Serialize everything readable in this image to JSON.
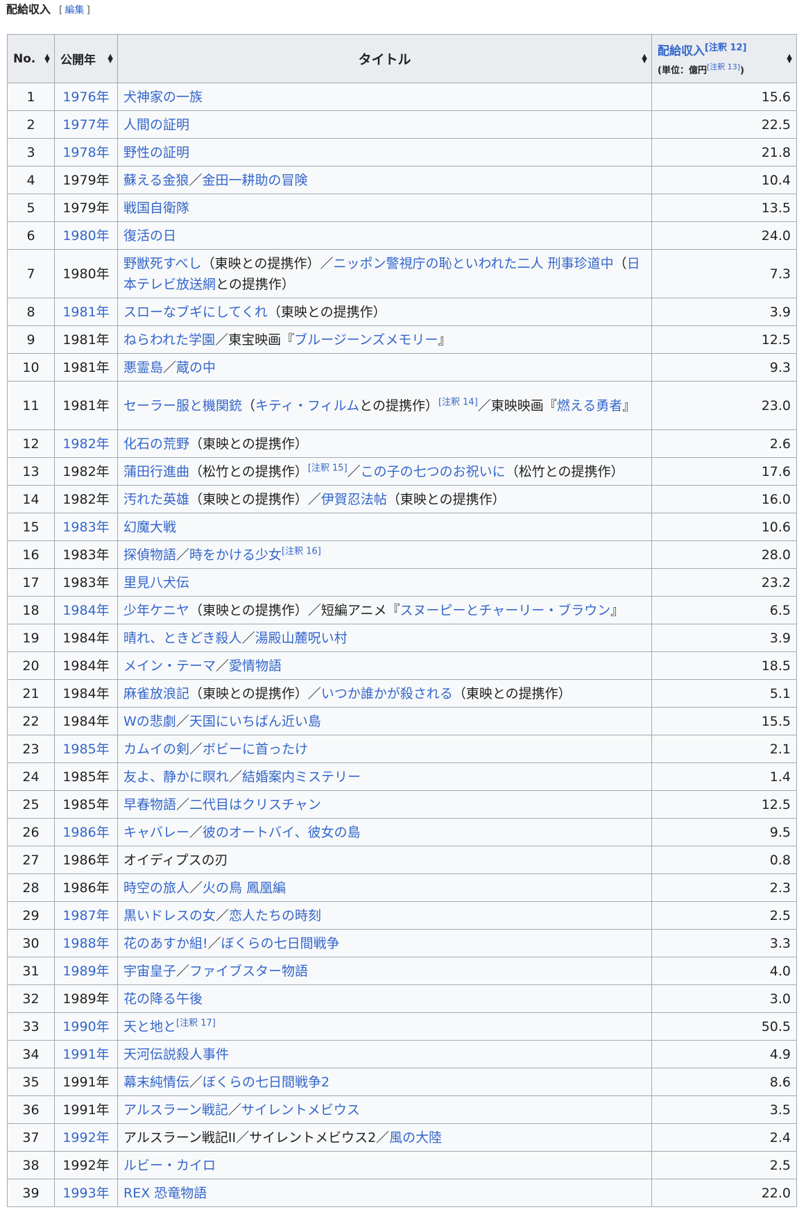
{
  "section": {
    "title": "配給収入",
    "edit_open": "[",
    "edit_label": "編集",
    "edit_close": "]"
  },
  "headers": {
    "no": "No.",
    "year": "公開年",
    "title": "タイトル",
    "revenue": "配給収入",
    "revenue_note": "[注釈 12]",
    "unit_prefix": "(単位：億円",
    "unit_note": "[注釈 13]",
    "unit_suffix": ")"
  },
  "rows": [
    {
      "no": "1",
      "year": "1976年",
      "year_link": true,
      "parts": [
        {
          "t": "犬神家の一族",
          "l": true
        }
      ],
      "rev": "15.6"
    },
    {
      "no": "2",
      "year": "1977年",
      "year_link": true,
      "parts": [
        {
          "t": "人間の証明",
          "l": true
        }
      ],
      "rev": "22.5"
    },
    {
      "no": "3",
      "year": "1978年",
      "year_link": true,
      "parts": [
        {
          "t": "野性の証明",
          "l": true
        }
      ],
      "rev": "21.8"
    },
    {
      "no": "4",
      "year": "1979年",
      "year_link": false,
      "parts": [
        {
          "t": "蘇える金狼",
          "l": true
        },
        {
          "t": "／",
          "l": false
        },
        {
          "t": "金田一耕助の冒険",
          "l": true
        }
      ],
      "rev": "10.4"
    },
    {
      "no": "5",
      "year": "1979年",
      "year_link": false,
      "parts": [
        {
          "t": "戦国自衛隊",
          "l": true
        }
      ],
      "rev": "13.5"
    },
    {
      "no": "6",
      "year": "1980年",
      "year_link": true,
      "parts": [
        {
          "t": "復活の日",
          "l": true
        }
      ],
      "rev": "24.0"
    },
    {
      "no": "7",
      "year": "1980年",
      "year_link": false,
      "tall": true,
      "parts": [
        {
          "t": "野獣死すべし",
          "l": true
        },
        {
          "t": "（東映との提携作）／",
          "l": false
        },
        {
          "t": "ニッポン警視庁の恥といわれた二人 刑事珍道中",
          "l": true
        },
        {
          "t": "（",
          "l": false
        },
        {
          "t": "日本テレビ放送網",
          "l": true
        },
        {
          "t": "との提携作）",
          "l": false
        }
      ],
      "rev": "7.3"
    },
    {
      "no": "8",
      "year": "1981年",
      "year_link": true,
      "parts": [
        {
          "t": "スローなブギにしてくれ",
          "l": true
        },
        {
          "t": "（東映との提携作）",
          "l": false
        }
      ],
      "rev": "3.9"
    },
    {
      "no": "9",
      "year": "1981年",
      "year_link": false,
      "parts": [
        {
          "t": "ねらわれた学園",
          "l": true
        },
        {
          "t": "／東宝映画『",
          "l": false
        },
        {
          "t": "ブルージーンズメモリー",
          "l": true
        },
        {
          "t": "』",
          "l": false
        }
      ],
      "rev": "12.5"
    },
    {
      "no": "10",
      "year": "1981年",
      "year_link": false,
      "parts": [
        {
          "t": "悪霊島",
          "l": true
        },
        {
          "t": "／",
          "l": false
        },
        {
          "t": "蔵の中",
          "l": true
        }
      ],
      "rev": "9.3"
    },
    {
      "no": "11",
      "year": "1981年",
      "year_link": false,
      "tall": true,
      "parts": [
        {
          "t": "セーラー服と機関銃",
          "l": true
        },
        {
          "t": "（",
          "l": false
        },
        {
          "t": "キティ・フィルム",
          "l": true
        },
        {
          "t": "との提携作）",
          "l": false
        },
        {
          "t": "[注釈 14]",
          "n": true
        },
        {
          "t": "／東映映画『",
          "l": false
        },
        {
          "t": "燃える勇者",
          "l": true
        },
        {
          "t": "』",
          "l": false
        }
      ],
      "rev": "23.0"
    },
    {
      "no": "12",
      "year": "1982年",
      "year_link": true,
      "parts": [
        {
          "t": "化石の荒野",
          "l": true
        },
        {
          "t": "（東映との提携作）",
          "l": false
        }
      ],
      "rev": "2.6"
    },
    {
      "no": "13",
      "year": "1982年",
      "year_link": false,
      "parts": [
        {
          "t": "蒲田行進曲",
          "l": true
        },
        {
          "t": "（松竹との提携作）",
          "l": false
        },
        {
          "t": "[注釈 15]",
          "n": true
        },
        {
          "t": "／",
          "l": false
        },
        {
          "t": "この子の七つのお祝いに",
          "l": true
        },
        {
          "t": "（松竹との提携作）",
          "l": false
        }
      ],
      "rev": "17.6"
    },
    {
      "no": "14",
      "year": "1982年",
      "year_link": false,
      "parts": [
        {
          "t": "汚れた英雄",
          "l": true
        },
        {
          "t": "（東映との提携作）／",
          "l": false
        },
        {
          "t": "伊賀忍法帖",
          "l": true
        },
        {
          "t": "（東映との提携作）",
          "l": false
        }
      ],
      "rev": "16.0"
    },
    {
      "no": "15",
      "year": "1983年",
      "year_link": true,
      "parts": [
        {
          "t": "幻魔大戦",
          "l": true
        }
      ],
      "rev": "10.6"
    },
    {
      "no": "16",
      "year": "1983年",
      "year_link": false,
      "parts": [
        {
          "t": "探偵物語",
          "l": true
        },
        {
          "t": "／",
          "l": false
        },
        {
          "t": "時をかける少女",
          "l": true
        },
        {
          "t": "[注釈 16]",
          "n": true
        }
      ],
      "rev": "28.0"
    },
    {
      "no": "17",
      "year": "1983年",
      "year_link": false,
      "parts": [
        {
          "t": "里見八犬伝",
          "l": true
        }
      ],
      "rev": "23.2"
    },
    {
      "no": "18",
      "year": "1984年",
      "year_link": true,
      "parts": [
        {
          "t": "少年ケニヤ",
          "l": true
        },
        {
          "t": "（東映との提携作）／短編アニメ『",
          "l": false
        },
        {
          "t": "スヌーピーとチャーリー・ブラウン",
          "l": true
        },
        {
          "t": "』",
          "l": false
        }
      ],
      "rev": "6.5"
    },
    {
      "no": "19",
      "year": "1984年",
      "year_link": false,
      "parts": [
        {
          "t": "晴れ、ときどき殺人",
          "l": true
        },
        {
          "t": "／",
          "l": false
        },
        {
          "t": "湯殿山麓呪い村",
          "l": true
        }
      ],
      "rev": "3.9"
    },
    {
      "no": "20",
      "year": "1984年",
      "year_link": false,
      "parts": [
        {
          "t": "メイン・テーマ",
          "l": true
        },
        {
          "t": "／",
          "l": false
        },
        {
          "t": "愛情物語",
          "l": true
        }
      ],
      "rev": "18.5"
    },
    {
      "no": "21",
      "year": "1984年",
      "year_link": false,
      "parts": [
        {
          "t": "麻雀放浪記",
          "l": true
        },
        {
          "t": "（東映との提携作）／",
          "l": false
        },
        {
          "t": "いつか誰かが殺される",
          "l": true
        },
        {
          "t": "（東映との提携作）",
          "l": false
        }
      ],
      "rev": "5.1"
    },
    {
      "no": "22",
      "year": "1984年",
      "year_link": false,
      "parts": [
        {
          "t": "Wの悲劇",
          "l": true
        },
        {
          "t": "／",
          "l": false
        },
        {
          "t": "天国にいちばん近い島",
          "l": true
        }
      ],
      "rev": "15.5"
    },
    {
      "no": "23",
      "year": "1985年",
      "year_link": true,
      "parts": [
        {
          "t": "カムイの剣",
          "l": true
        },
        {
          "t": "／",
          "l": false
        },
        {
          "t": "ボビーに首ったけ",
          "l": true
        }
      ],
      "rev": "2.1"
    },
    {
      "no": "24",
      "year": "1985年",
      "year_link": false,
      "parts": [
        {
          "t": "友よ、静かに瞑れ",
          "l": true
        },
        {
          "t": "／",
          "l": false
        },
        {
          "t": "結婚案内ミステリー",
          "l": true
        }
      ],
      "rev": "1.4"
    },
    {
      "no": "25",
      "year": "1985年",
      "year_link": false,
      "parts": [
        {
          "t": "早春物語",
          "l": true
        },
        {
          "t": "／",
          "l": false
        },
        {
          "t": "二代目はクリスチャン",
          "l": true
        }
      ],
      "rev": "12.5"
    },
    {
      "no": "26",
      "year": "1986年",
      "year_link": true,
      "parts": [
        {
          "t": "キャバレー",
          "l": true
        },
        {
          "t": "／",
          "l": false
        },
        {
          "t": "彼のオートバイ、彼女の島",
          "l": true
        }
      ],
      "rev": "9.5"
    },
    {
      "no": "27",
      "year": "1986年",
      "year_link": false,
      "parts": [
        {
          "t": "オイディプスの刃",
          "l": false
        }
      ],
      "rev": "0.8"
    },
    {
      "no": "28",
      "year": "1986年",
      "year_link": false,
      "parts": [
        {
          "t": "時空の旅人",
          "l": true
        },
        {
          "t": "／",
          "l": false
        },
        {
          "t": "火の鳥 鳳凰編",
          "l": true
        }
      ],
      "rev": "2.3"
    },
    {
      "no": "29",
      "year": "1987年",
      "year_link": true,
      "parts": [
        {
          "t": "黒いドレスの女",
          "l": true
        },
        {
          "t": "／",
          "l": false
        },
        {
          "t": "恋人たちの時刻",
          "l": true
        }
      ],
      "rev": "2.5"
    },
    {
      "no": "30",
      "year": "1988年",
      "year_link": true,
      "parts": [
        {
          "t": "花のあすか組!",
          "l": true
        },
        {
          "t": "／",
          "l": false
        },
        {
          "t": "ぼくらの七日間戦争",
          "l": true
        }
      ],
      "rev": "3.3"
    },
    {
      "no": "31",
      "year": "1989年",
      "year_link": true,
      "parts": [
        {
          "t": "宇宙皇子",
          "l": true
        },
        {
          "t": "／",
          "l": false
        },
        {
          "t": "ファイブスター物語",
          "l": true
        }
      ],
      "rev": "4.0"
    },
    {
      "no": "32",
      "year": "1989年",
      "year_link": false,
      "parts": [
        {
          "t": "花の降る午後",
          "l": true
        }
      ],
      "rev": "3.0"
    },
    {
      "no": "33",
      "year": "1990年",
      "year_link": true,
      "parts": [
        {
          "t": "天と地と",
          "l": true
        },
        {
          "t": "[注釈 17]",
          "n": true
        }
      ],
      "rev": "50.5"
    },
    {
      "no": "34",
      "year": "1991年",
      "year_link": true,
      "parts": [
        {
          "t": "天河伝説殺人事件",
          "l": true
        }
      ],
      "rev": "4.9"
    },
    {
      "no": "35",
      "year": "1991年",
      "year_link": false,
      "parts": [
        {
          "t": "幕末純情伝",
          "l": true
        },
        {
          "t": "／",
          "l": false
        },
        {
          "t": "ぼくらの七日間戦争2",
          "l": true
        }
      ],
      "rev": "8.6"
    },
    {
      "no": "36",
      "year": "1991年",
      "year_link": false,
      "parts": [
        {
          "t": "アルスラーン戦記",
          "l": true
        },
        {
          "t": "／",
          "l": false
        },
        {
          "t": "サイレントメビウス",
          "l": true
        }
      ],
      "rev": "3.5"
    },
    {
      "no": "37",
      "year": "1992年",
      "year_link": true,
      "parts": [
        {
          "t": "アルスラーン戦記II／サイレントメビウス2／",
          "l": false
        },
        {
          "t": "風の大陸",
          "l": true
        }
      ],
      "rev": "2.4"
    },
    {
      "no": "38",
      "year": "1992年",
      "year_link": false,
      "parts": [
        {
          "t": "ルビー・カイロ",
          "l": true
        }
      ],
      "rev": "2.5"
    },
    {
      "no": "39",
      "year": "1993年",
      "year_link": true,
      "parts": [
        {
          "t": "REX 恐竜物語",
          "l": true
        }
      ],
      "rev": "22.0"
    }
  ]
}
